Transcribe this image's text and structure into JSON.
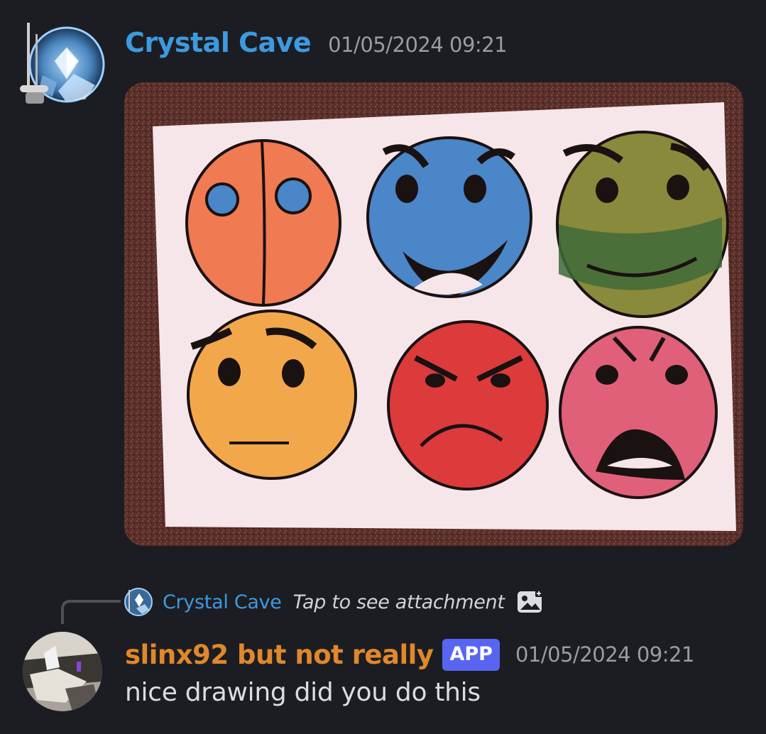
{
  "message1": {
    "author": "Crystal Cave",
    "timestamp": "01/05/2024 09:21",
    "attachment": {
      "faces": [
        {
          "color": "#f07a52",
          "expression": "split-round-eyes"
        },
        {
          "color": "#4a86c8",
          "expression": "grinning-angry-brows"
        },
        {
          "color": "#8a8a3c",
          "expression": "masked-smirk"
        },
        {
          "color": "#f2a84a",
          "expression": "worried-neutral"
        },
        {
          "color": "#dd3a3c",
          "expression": "angry-frown"
        },
        {
          "color": "#e0607a",
          "expression": "angry-shouting"
        }
      ]
    }
  },
  "reply": {
    "author": "Crystal Cave",
    "text": "Tap to see attachment",
    "icon": "image-icon"
  },
  "message2": {
    "author": "slinx92 but not really",
    "badge": "APP",
    "timestamp": "01/05/2024 09:21",
    "body": "nice drawing did you do this"
  },
  "colors": {
    "background": "#1c1d22",
    "author1": "#3c9ae0",
    "author2": "#e0882b",
    "badge": "#5865f2",
    "timestamp": "#9a9ca4"
  }
}
